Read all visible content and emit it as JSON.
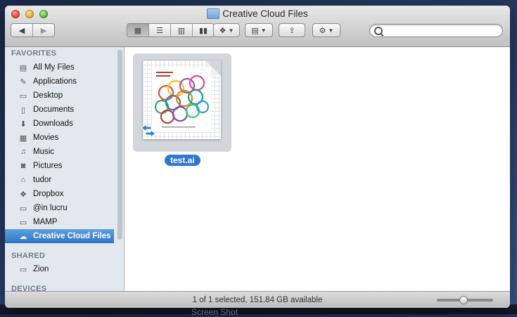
{
  "window": {
    "title": "Creative Cloud Files"
  },
  "toolbar": {
    "nav_back_icon": "chevron-left-icon",
    "nav_forward_icon": "chevron-right-icon",
    "views": [
      "icon-view-icon",
      "list-view-icon",
      "column-view-icon",
      "coverflow-view-icon"
    ],
    "search_placeholder": ""
  },
  "sidebar": {
    "favorites_header": "FAVORITES",
    "favorites": [
      {
        "label": "All My Files",
        "icon": "all-files-icon"
      },
      {
        "label": "Applications",
        "icon": "applications-icon"
      },
      {
        "label": "Desktop",
        "icon": "desktop-icon"
      },
      {
        "label": "Documents",
        "icon": "documents-icon"
      },
      {
        "label": "Downloads",
        "icon": "downloads-icon"
      },
      {
        "label": "Movies",
        "icon": "movies-icon"
      },
      {
        "label": "Music",
        "icon": "music-icon"
      },
      {
        "label": "Pictures",
        "icon": "pictures-icon"
      },
      {
        "label": "tudor",
        "icon": "home-icon"
      },
      {
        "label": "Dropbox",
        "icon": "dropbox-icon"
      },
      {
        "label": "@in lucru",
        "icon": "folder-icon"
      },
      {
        "label": "MAMP",
        "icon": "folder-icon"
      },
      {
        "label": "Creative Cloud Files",
        "icon": "creative-cloud-icon"
      }
    ],
    "shared_header": "SHARED",
    "shared": [
      {
        "label": "Zion",
        "icon": "server-icon"
      }
    ],
    "devices_header": "DEVICES"
  },
  "files": [
    {
      "name": "test.ai",
      "selected": true
    }
  ],
  "status": {
    "text": "1 of 1 selected, 151.84 GB available",
    "zoom_fraction": 0.45
  },
  "desktop": {
    "label": "Screen Shot"
  }
}
